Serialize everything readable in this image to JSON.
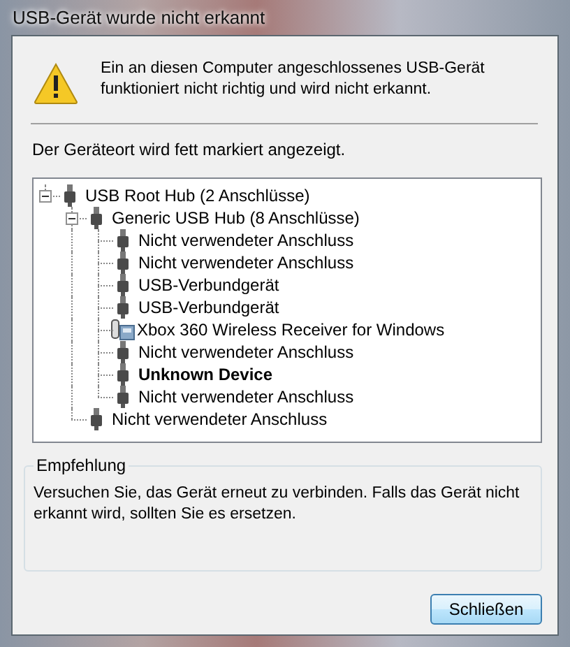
{
  "window": {
    "title": "USB-Gerät wurde nicht erkannt"
  },
  "message": "Ein an diesen Computer angeschlossenes USB-Gerät funktioniert nicht richtig und wird nicht erkannt.",
  "hint": "Der Geräteort wird fett markiert angezeigt.",
  "tree": [
    {
      "label": "USB Root Hub (2 Anschlüsse)",
      "kind": "usb",
      "bold": false,
      "expanded": true,
      "children": [
        {
          "label": "Generic USB Hub (8 Anschlüsse)",
          "kind": "usb",
          "bold": false,
          "expanded": true,
          "children": [
            {
              "label": "Nicht verwendeter Anschluss",
              "kind": "usb",
              "bold": false
            },
            {
              "label": "Nicht verwendeter Anschluss",
              "kind": "usb",
              "bold": false
            },
            {
              "label": "USB-Verbundgerät",
              "kind": "usb",
              "bold": false
            },
            {
              "label": "USB-Verbundgerät",
              "kind": "usb",
              "bold": false
            },
            {
              "label": "Xbox 360 Wireless Receiver for Windows",
              "kind": "receiver",
              "bold": false
            },
            {
              "label": "Nicht verwendeter Anschluss",
              "kind": "usb",
              "bold": false
            },
            {
              "label": "Unknown Device",
              "kind": "usb",
              "bold": true
            },
            {
              "label": "Nicht verwendeter Anschluss",
              "kind": "usb",
              "bold": false
            }
          ]
        },
        {
          "label": "Nicht verwendeter Anschluss",
          "kind": "usb",
          "bold": false
        }
      ]
    }
  ],
  "recommendation": {
    "title": "Empfehlung",
    "text": "Versuchen Sie, das Gerät erneut zu verbinden. Falls das Gerät nicht erkannt wird, sollten Sie es ersetzen."
  },
  "buttons": [
    "Schließen"
  ]
}
